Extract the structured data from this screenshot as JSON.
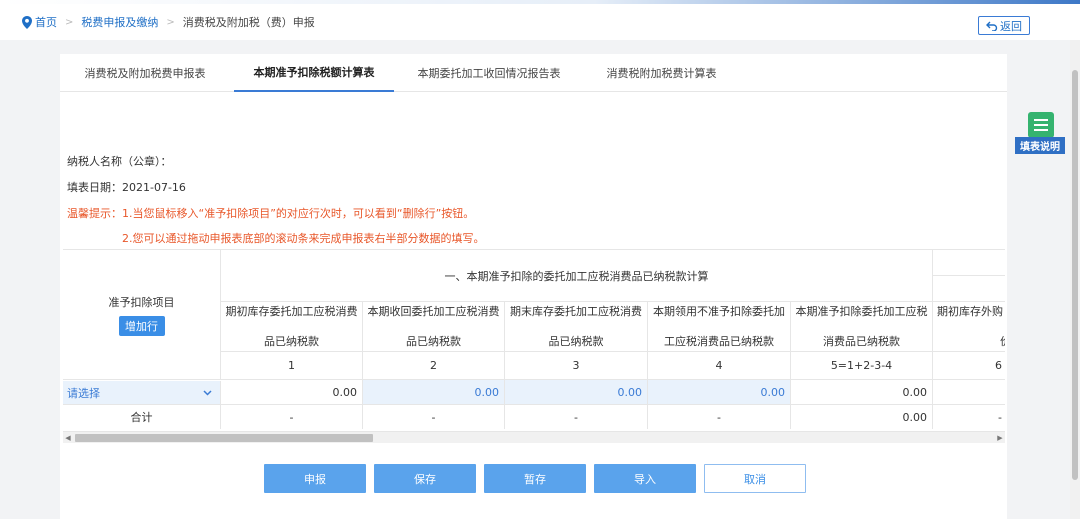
{
  "breadcrumb": {
    "home": "首页",
    "level2": "税费申报及缴纳",
    "current": "消费税及附加税（费）申报",
    "return_label": "返回"
  },
  "tabs": [
    {
      "label": "消费税及附加税费申报表"
    },
    {
      "label": "本期准予扣除税额计算表"
    },
    {
      "label": "本期委托加工收回情况报告表"
    },
    {
      "label": "消费税附加税费计算表"
    }
  ],
  "form_info": {
    "taxpayer_label": "纳税人名称（公章）：",
    "date_label": "填表日期：",
    "date_value": "2021-07-16",
    "tip_label": "温馨提示：",
    "tip1": "1.当您鼠标移入“准予扣除项目”的对应行次时，可以看到“删除行”按钮。",
    "tip2": "2.您可以通过拖动申报表底部的滚动条来完成申报表右半部分数据的填写。"
  },
  "table": {
    "item_header": "准予扣除项目",
    "add_row_label": "增加行",
    "group_header": "一、本期准予扣除的委托加工应税消费品已纳税款计算",
    "columns": [
      {
        "line1": "期初库存委托加工应税消费",
        "line2": "品已纳税款",
        "index": "1"
      },
      {
        "line1": "本期收回委托加工应税消费",
        "line2": "品已纳税款",
        "index": "2"
      },
      {
        "line1": "期末库存委托加工应税消费",
        "line2": "品已纳税款",
        "index": "3"
      },
      {
        "line1": "本期领用不准予扣除委托加",
        "line2": "工应税消费品已纳税款",
        "index": "4"
      },
      {
        "line1": "本期准予扣除委托加工应税",
        "line2": "消费品已纳税款",
        "index": "5=1+2-3-4"
      },
      {
        "line1": "期初库存外购",
        "line2": "价",
        "index": "6"
      }
    ],
    "select_placeholder": "请选择",
    "row1": [
      "0.00",
      "0.00",
      "0.00",
      "0.00",
      "0.00",
      ""
    ],
    "total_label": "合计",
    "total_row": [
      "-",
      "-",
      "-",
      "-",
      "0.00",
      "-"
    ]
  },
  "actions": {
    "submit": "申报",
    "save": "保存",
    "temp_save": "暂存",
    "import": "导入",
    "cancel": "取消"
  },
  "helper": {
    "label": "填表说明"
  },
  "colors": {
    "accent": "#3a8ee6",
    "warning": "#e8572a",
    "helper_green": "#35b36f",
    "helper_blue": "#2f6fc4"
  }
}
